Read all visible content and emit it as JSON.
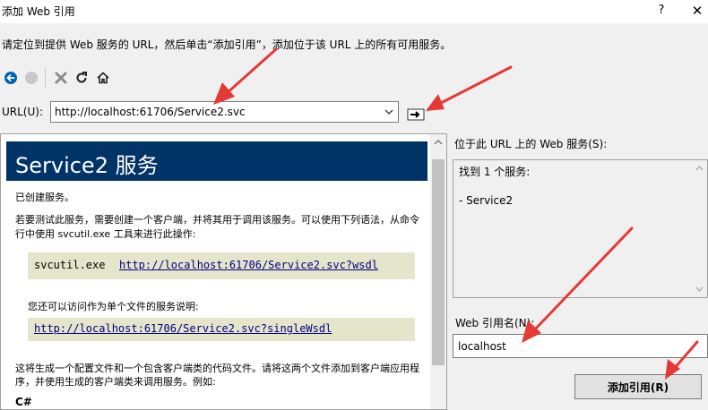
{
  "window": {
    "title": "添加 Web 引用",
    "help_glyph": "?",
    "close_glyph": "✕"
  },
  "instruction": "请定位到提供 Web 服务的 URL，然后单击“添加引用”，添加位于该 URL 上的所有可用服务。",
  "toolbar": {
    "icons": [
      "back-icon",
      "forward-icon",
      "stop-icon",
      "refresh-icon",
      "home-icon"
    ]
  },
  "url": {
    "label": "URL(U):",
    "value": "http://localhost:61706/Service2.svc"
  },
  "preview": {
    "banner_title": "Service2 服务",
    "created": "已创建服务。",
    "test_line1": "若要测试此服务，需要创建一个客户端，并将其用于调用该服务。可以使用下列语法，从命令",
    "test_line2": "行中使用 svcutil.exe 工具来进行此操作:",
    "svcutil_cmd": "svcutil.exe",
    "wsdl_link": "http://localhost:61706/Service2.svc?wsdl",
    "single_note": "您还可以访问作为单个文件的服务说明:",
    "single_link": "http://localhost:61706/Service2.svc?singleWsdl",
    "gen_line1": "这将生成一个配置文件和一个包含客户端类的代码文件。请将这两个文件添加到客户端应用程",
    "gen_line2": "序，并使用生成的客户端类来调用服务。例如:",
    "lang": "C#"
  },
  "services_panel": {
    "label": "位于此 URL 上的 Web 服务(S):",
    "found": "找到 1 个服务:",
    "item": "- Service2"
  },
  "reference": {
    "label": "Web 引用名(N):",
    "value": "localhost",
    "add_button": "添加引用(R)"
  },
  "colors": {
    "banner": "#003366",
    "code_bg": "#e5e5cc",
    "link": "#000080",
    "annotation_arrow": "#e53935",
    "back_icon": "#0063b1"
  }
}
